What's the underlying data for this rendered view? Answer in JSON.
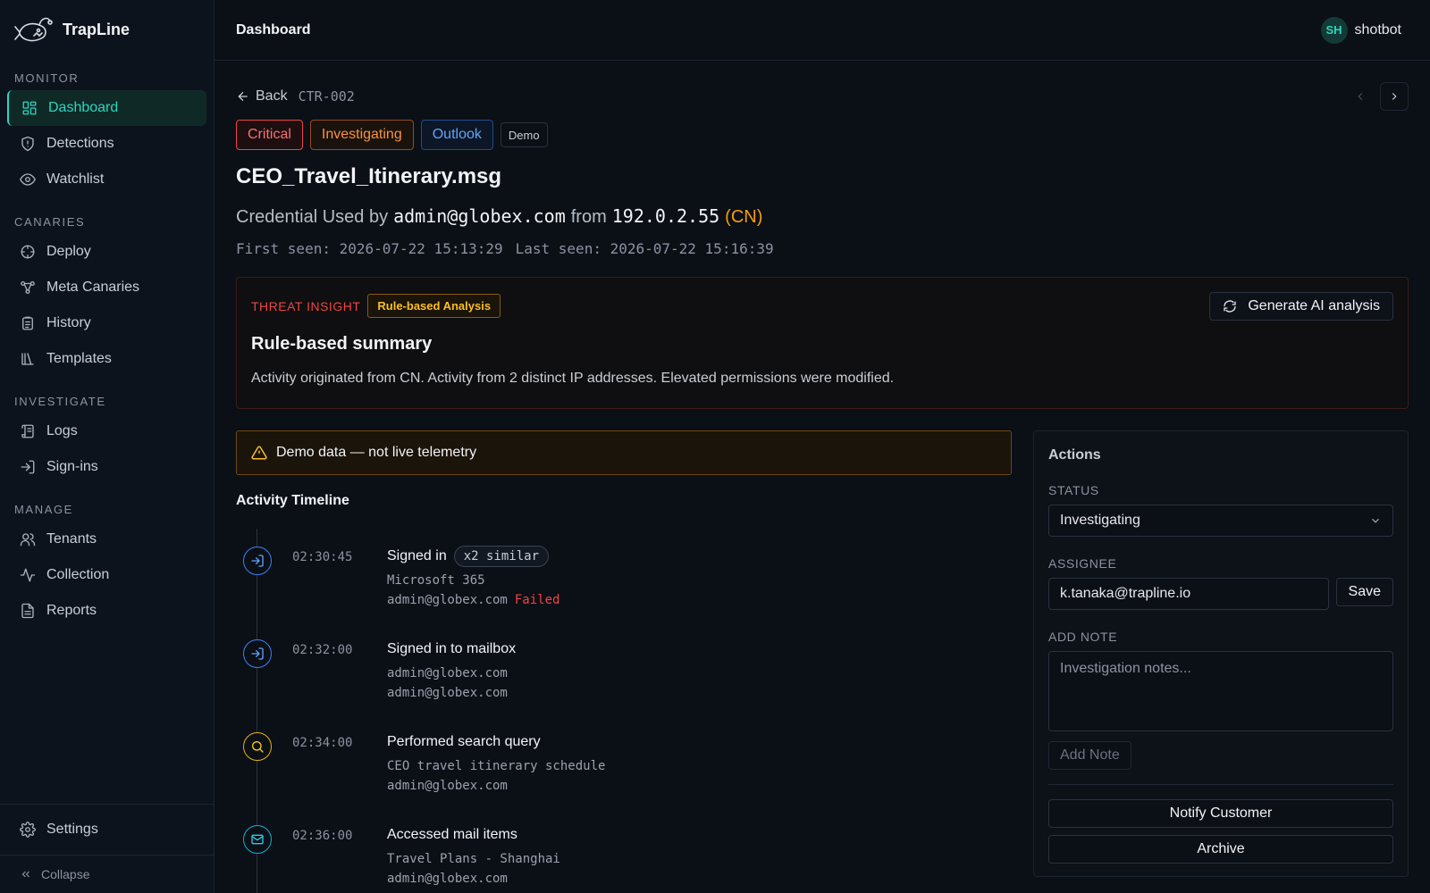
{
  "brand": {
    "name": "TrapLine"
  },
  "sidebar": {
    "sections": [
      {
        "heading": "MONITOR",
        "items": [
          {
            "label": "Dashboard",
            "icon": "dashboard-icon",
            "active": true
          },
          {
            "label": "Detections",
            "icon": "shield-icon"
          },
          {
            "label": "Watchlist",
            "icon": "eye-icon"
          }
        ]
      },
      {
        "heading": "CANARIES",
        "items": [
          {
            "label": "Deploy",
            "icon": "crosshair-icon"
          },
          {
            "label": "Meta Canaries",
            "icon": "nodes-icon"
          },
          {
            "label": "History",
            "icon": "clipboard-icon"
          },
          {
            "label": "Templates",
            "icon": "library-icon"
          }
        ]
      },
      {
        "heading": "INVESTIGATE",
        "items": [
          {
            "label": "Logs",
            "icon": "scroll-icon"
          },
          {
            "label": "Sign-ins",
            "icon": "login-icon"
          }
        ]
      },
      {
        "heading": "MANAGE",
        "items": [
          {
            "label": "Tenants",
            "icon": "users-icon"
          },
          {
            "label": "Collection",
            "icon": "activity-icon"
          },
          {
            "label": "Reports",
            "icon": "file-icon"
          }
        ]
      }
    ],
    "settings_label": "Settings",
    "collapse_label": "Collapse"
  },
  "topbar": {
    "title": "Dashboard",
    "avatar_initials": "SH",
    "username": "shotbot"
  },
  "detail": {
    "back_label": "Back",
    "id": "CTR-002",
    "badges": {
      "severity": "Critical",
      "status": "Investigating",
      "source": "Outlook",
      "demo": "Demo"
    },
    "title": "CEO_Travel_Itinerary.msg",
    "subtitle": {
      "prefix": "Credential Used by",
      "account": "admin@globex.com",
      "from": "from",
      "ip": "192.0.2.55",
      "country": "(CN)"
    },
    "first_seen": "First seen: 2026-07-22 15:13:29",
    "last_seen": "Last seen: 2026-07-22 15:16:39"
  },
  "insight": {
    "label": "THREAT INSIGHT",
    "chip": "Rule-based Analysis",
    "ai_button": "Generate AI analysis",
    "title": "Rule-based summary",
    "text": "Activity originated from CN. Activity from 2 distinct IP addresses. Elevated permissions were modified."
  },
  "warning": "Demo data — not live telemetry",
  "timeline": {
    "title": "Activity Timeline",
    "events": [
      {
        "time": "02:30:45",
        "title": "Signed in",
        "chip": "x2 similar",
        "line1": "Microsoft 365",
        "line2": "admin@globex.com",
        "status": "Failed",
        "icon": "login-icon",
        "color": "blue"
      },
      {
        "time": "02:32:00",
        "title": "Signed in to mailbox",
        "line1": "admin@globex.com",
        "line2": "admin@globex.com",
        "icon": "login-icon",
        "color": "blue"
      },
      {
        "time": "02:34:00",
        "title": "Performed search query",
        "line1": "CEO travel itinerary schedule",
        "line2": "admin@globex.com",
        "icon": "search-icon",
        "color": "yellow"
      },
      {
        "time": "02:36:00",
        "title": "Accessed mail items",
        "line1": "Travel Plans - Shanghai",
        "line2": "admin@globex.com",
        "icon": "mail-icon",
        "color": "cyan"
      }
    ]
  },
  "actions": {
    "title": "Actions",
    "status_label": "STATUS",
    "status_value": "Investigating",
    "assignee_label": "ASSIGNEE",
    "assignee_value": "k.tanaka@trapline.io",
    "save_label": "Save",
    "note_label": "ADD NOTE",
    "note_placeholder": "Investigation notes...",
    "add_note_label": "Add Note",
    "notify_label": "Notify Customer",
    "archive_label": "Archive"
  }
}
